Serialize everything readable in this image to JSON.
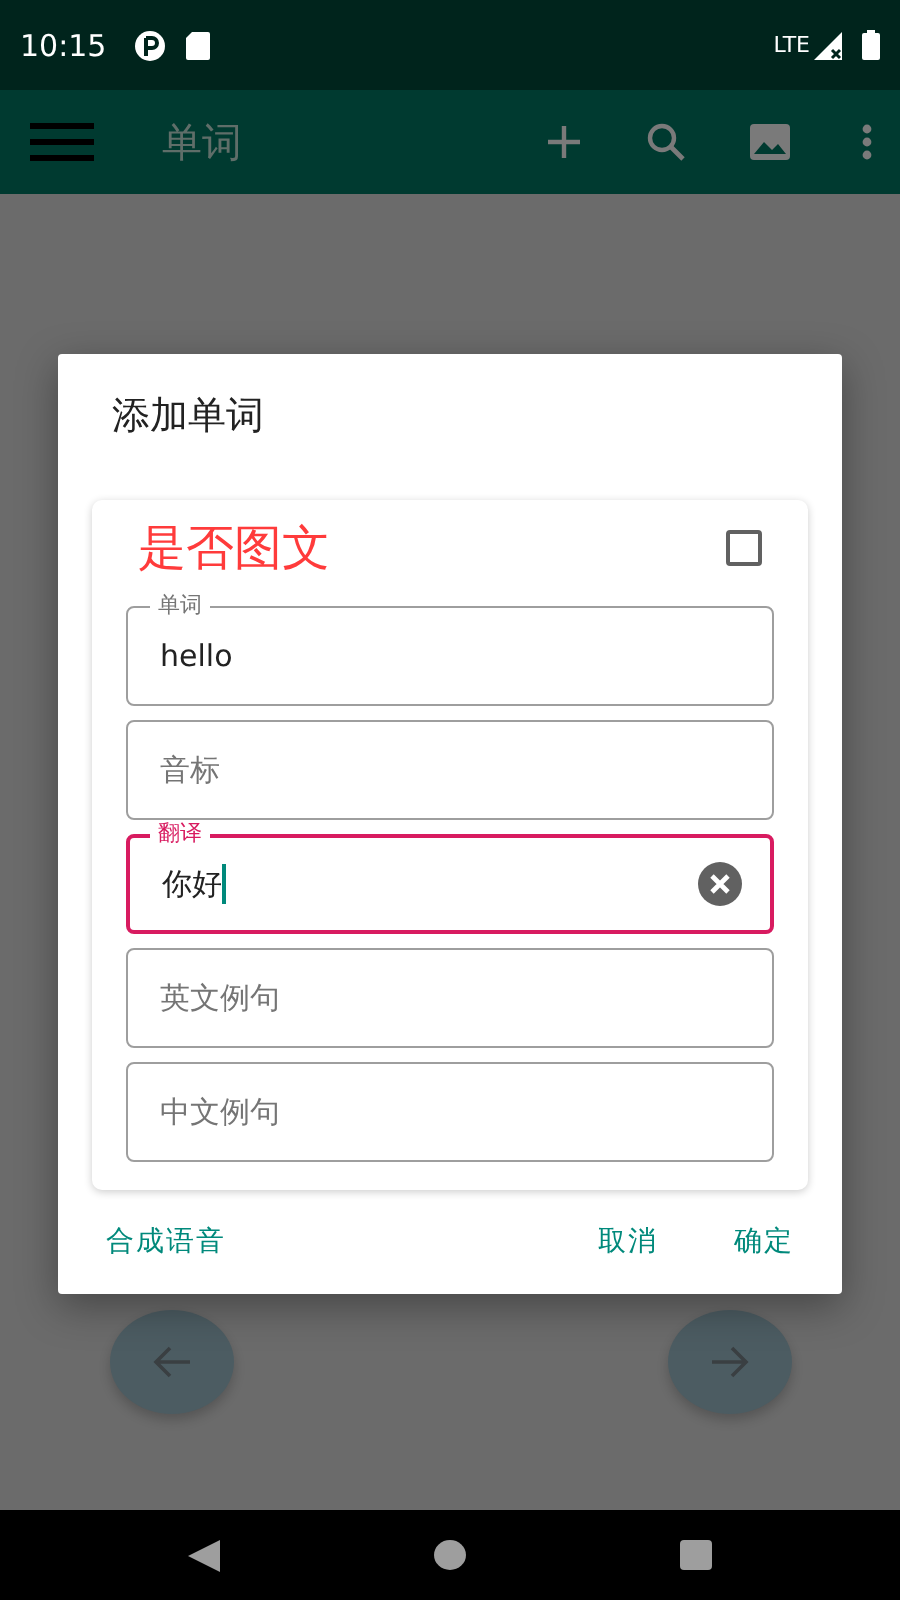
{
  "status_bar": {
    "time": "10:15",
    "network": "LTE"
  },
  "app_bar": {
    "title": "单词"
  },
  "dialog": {
    "title": "添加单词",
    "image_text_toggle": {
      "label": "是否图文",
      "checked": false
    },
    "fields": [
      {
        "label": "单词",
        "value": "hello",
        "focused": false
      },
      {
        "placeholder": "音标",
        "focused": false
      },
      {
        "label": "翻译",
        "value": "你好",
        "focused": true
      },
      {
        "placeholder": "英文例句",
        "focused": false
      },
      {
        "placeholder": "中文例句",
        "focused": false
      }
    ],
    "buttons": [
      "合成语音",
      "取消",
      "确定"
    ]
  }
}
